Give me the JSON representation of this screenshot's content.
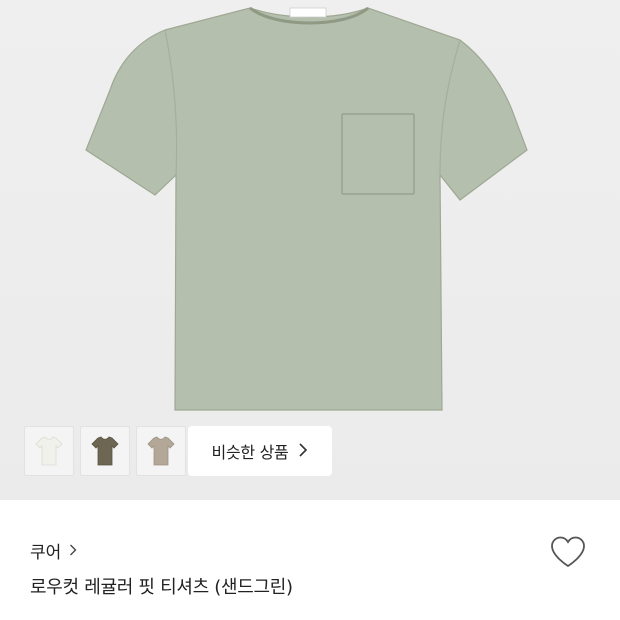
{
  "product": {
    "brand": "쿠어",
    "title": "로우컷 레귤러 핏 티셔츠 (샌드그린)",
    "shirt_color": "#b5bfad"
  },
  "gallery": {
    "thumbnails": [
      {
        "name": "ivory",
        "color": "#f1f1ec"
      },
      {
        "name": "khaki-brown",
        "color": "#6c6652"
      },
      {
        "name": "beige",
        "color": "#b3a898"
      }
    ],
    "similar_button_label": "비슷한 상품",
    "similar_button_icon": "chevron-right-icon"
  },
  "icons": {
    "wishlist": "heart-outline-icon",
    "brand_link": "chevron-right-icon"
  }
}
